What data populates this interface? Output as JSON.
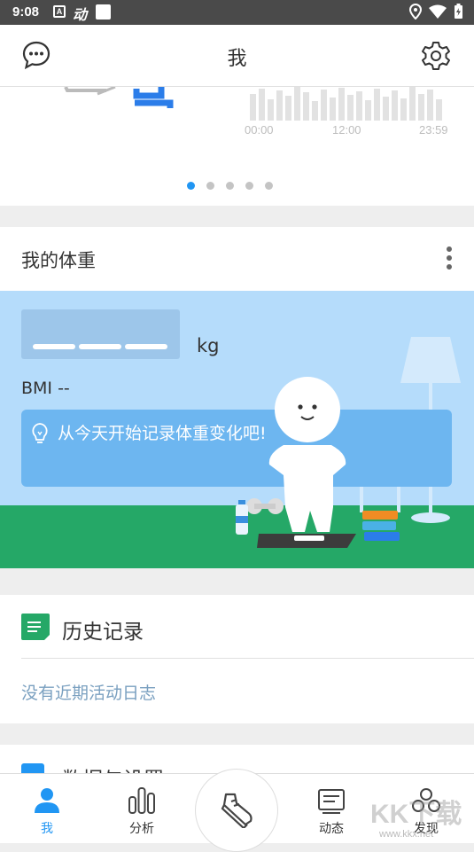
{
  "status_bar": {
    "time": "9:08",
    "app_icon_letter": "A",
    "app_icon_text": "动"
  },
  "header": {
    "title": "我",
    "left_icon": "message-icon",
    "right_icon": "gear-icon"
  },
  "carousel": {
    "x_ticks": [
      "00:00",
      "12:00",
      "23:59"
    ],
    "page_count": 5,
    "active_page": 1
  },
  "weight_card": {
    "title": "我的体重",
    "unit": "kg",
    "bmi": "BMI --",
    "tip": "从今天开始记录体重变化吧!"
  },
  "history": {
    "title": "历史记录",
    "empty_text": "没有近期活动日志"
  },
  "settings": {
    "title": "数据与设置"
  },
  "bottom_nav": {
    "items": [
      {
        "label": "我",
        "icon": "person-icon"
      },
      {
        "label": "分析",
        "icon": "bar-chart-icon"
      },
      {
        "label": "",
        "icon": "shoe-icon"
      },
      {
        "label": "动态",
        "icon": "feed-icon"
      },
      {
        "label": "发现",
        "icon": "discover-icon"
      }
    ]
  },
  "watermark": {
    "text": "KK下载",
    "sub": "www.kkx.net"
  },
  "colors": {
    "accent": "#2196f3",
    "sky": "#b5dcfb",
    "floor": "#25a867",
    "history_green": "#25a867"
  }
}
